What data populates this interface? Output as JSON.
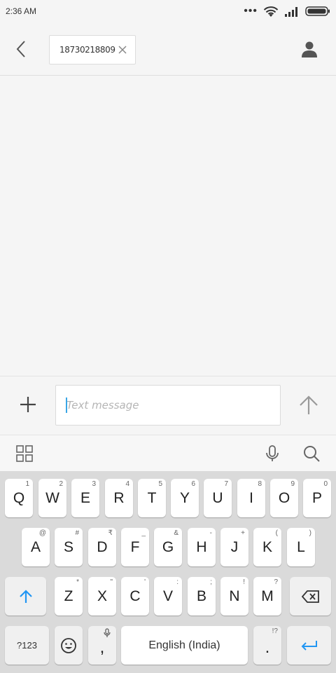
{
  "status_bar": {
    "time": "2:36 AM",
    "icons": [
      "more-dots-icon",
      "wifi-icon",
      "signal-icon",
      "battery-icon"
    ]
  },
  "header": {
    "recipient": "18730218809",
    "icons": [
      "back-arrow-icon",
      "close-icon",
      "contact-icon"
    ]
  },
  "compose": {
    "placeholder": "Text message",
    "value": "",
    "icons": [
      "plus-icon",
      "send-arrow-icon"
    ]
  },
  "keyboard_toolbar": {
    "icons": [
      "grid-icon",
      "microphone-icon",
      "search-icon"
    ]
  },
  "keyboard": {
    "row1": [
      {
        "label": "Q",
        "hint": "1"
      },
      {
        "label": "W",
        "hint": "2"
      },
      {
        "label": "E",
        "hint": "3"
      },
      {
        "label": "R",
        "hint": "4"
      },
      {
        "label": "T",
        "hint": "5"
      },
      {
        "label": "Y",
        "hint": "6"
      },
      {
        "label": "U",
        "hint": "7"
      },
      {
        "label": "I",
        "hint": "8"
      },
      {
        "label": "O",
        "hint": "9"
      },
      {
        "label": "P",
        "hint": "0"
      }
    ],
    "row2": [
      {
        "label": "A",
        "hint": "@"
      },
      {
        "label": "S",
        "hint": "#"
      },
      {
        "label": "D",
        "hint": "₹"
      },
      {
        "label": "F",
        "hint": "_"
      },
      {
        "label": "G",
        "hint": "&"
      },
      {
        "label": "H",
        "hint": "-"
      },
      {
        "label": "J",
        "hint": "+"
      },
      {
        "label": "K",
        "hint": "("
      },
      {
        "label": "L",
        "hint": ")"
      }
    ],
    "row3": [
      {
        "label": "Z",
        "hint": "*"
      },
      {
        "label": "X",
        "hint": "\""
      },
      {
        "label": "C",
        "hint": "'"
      },
      {
        "label": "V",
        "hint": ":"
      },
      {
        "label": "B",
        "hint": ";"
      },
      {
        "label": "N",
        "hint": "!"
      },
      {
        "label": "M",
        "hint": "?"
      }
    ],
    "symbols_label": "?123",
    "comma_label": ",",
    "space_label": "English (India)",
    "period_label": ".",
    "period_hint": "!?",
    "accent_color": "#2196f3"
  }
}
